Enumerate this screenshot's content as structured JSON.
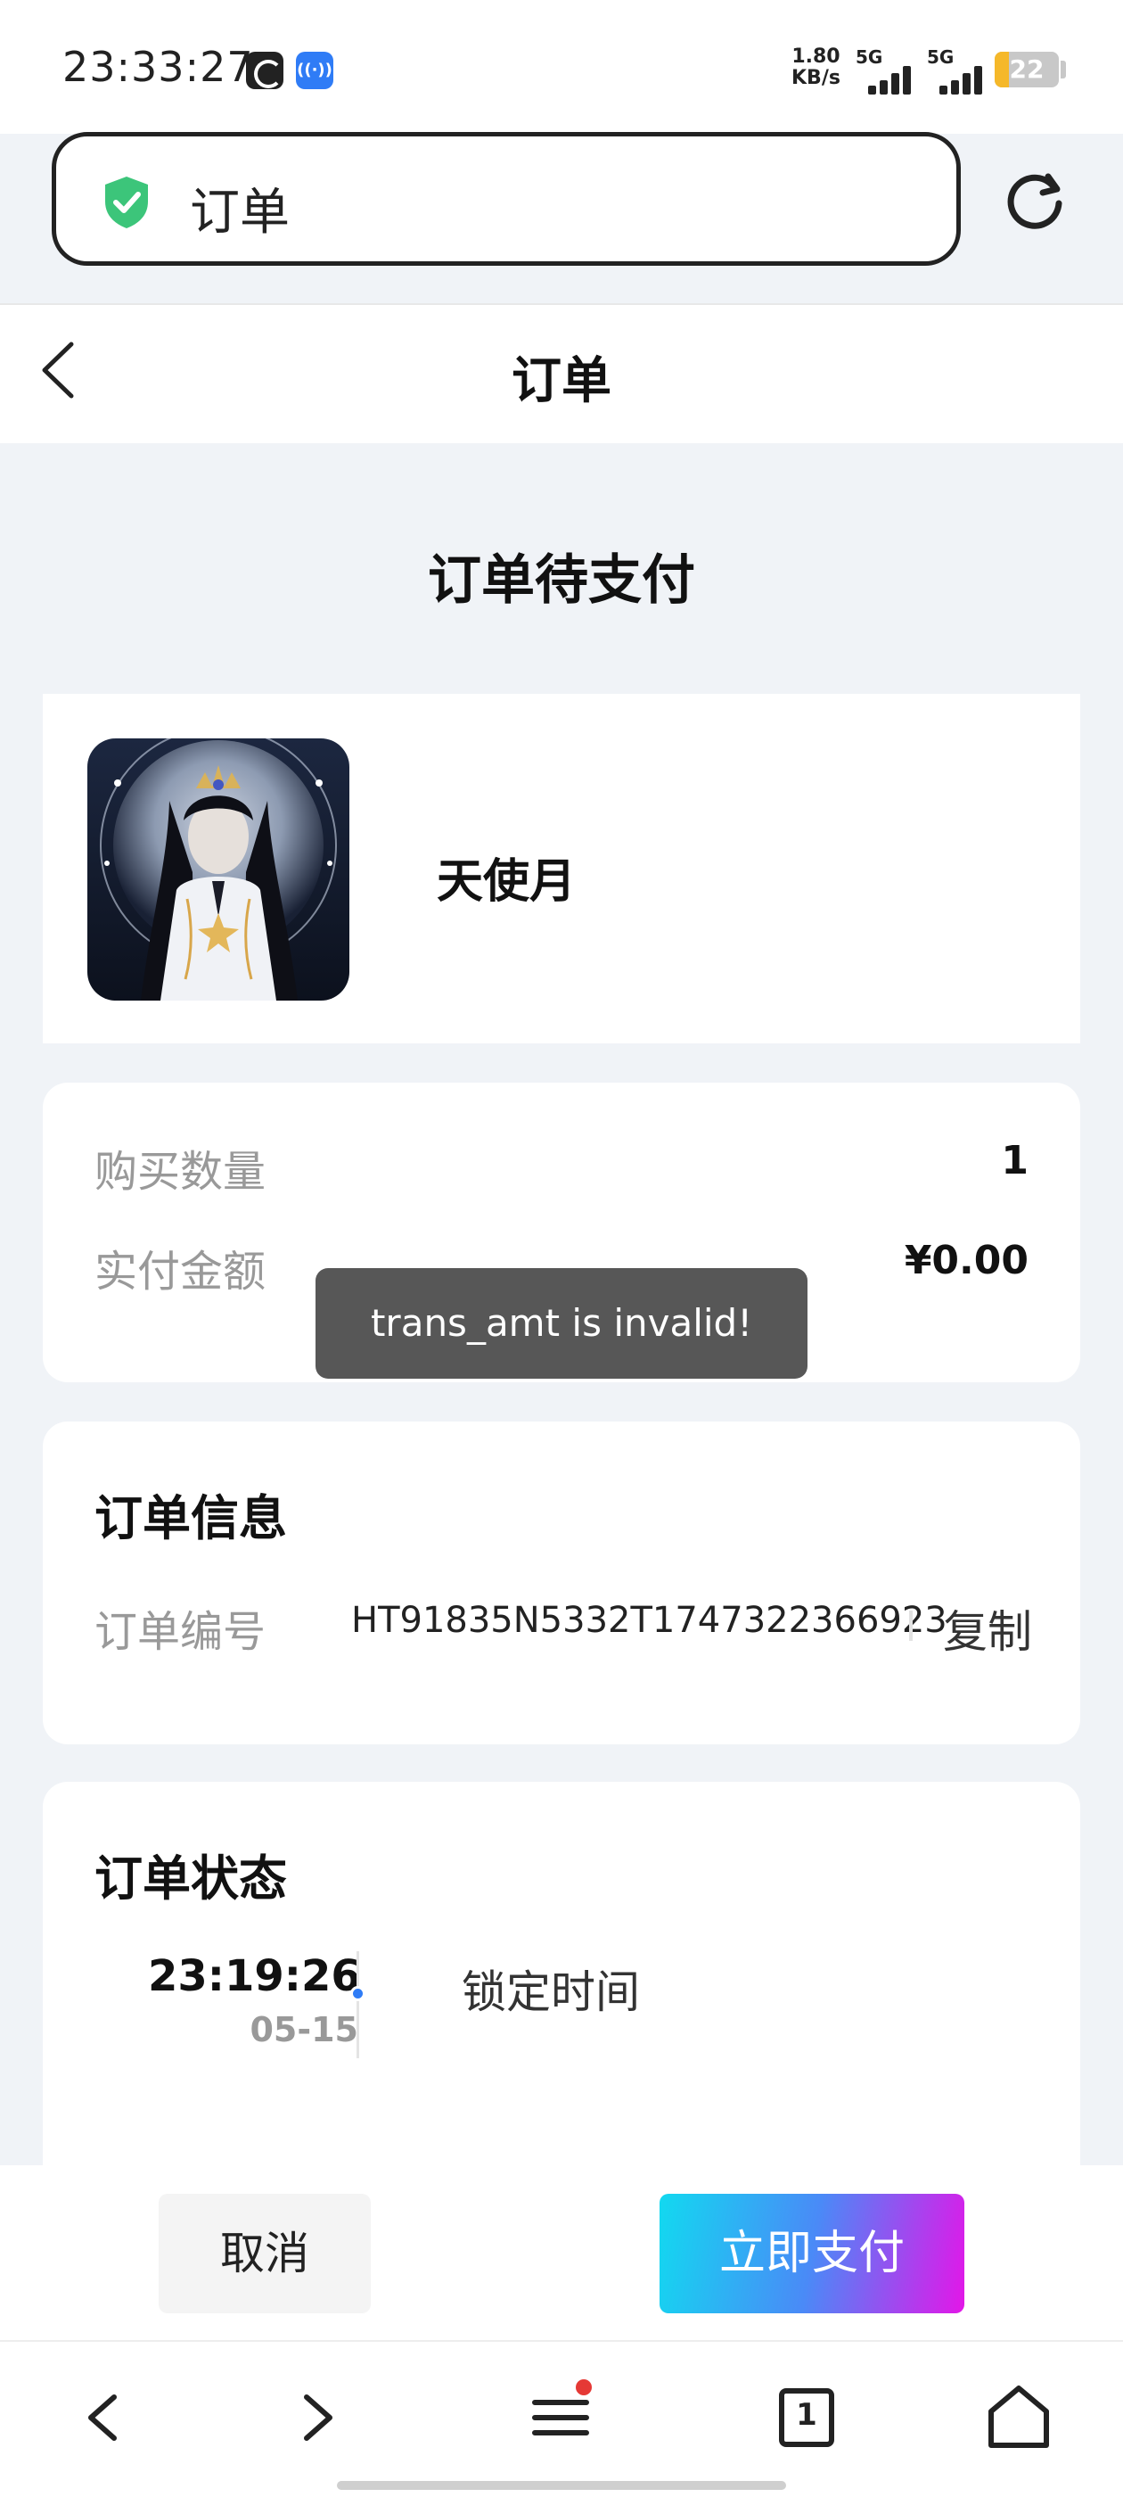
{
  "status_bar": {
    "time": "23:33:27",
    "network_speed_value": "1.80",
    "network_speed_unit": "KB/s",
    "signal1_label": "5G",
    "signal2_label": "5G",
    "battery_level": "22",
    "colors": {
      "battery_fill": "#f5b82a",
      "app_icon_blue": "#2f7cf6"
    },
    "icons": [
      "app-status-icon",
      "nfc-icon",
      "signal-icon",
      "battery-icon"
    ]
  },
  "address_bar": {
    "text": "订单",
    "security_icon": "shield-check-icon",
    "reload_icon": "refresh-icon"
  },
  "header": {
    "title": "订单",
    "back_icon": "chevron-left-icon"
  },
  "order": {
    "heading": "订单待支付",
    "product": {
      "name": "天使月",
      "image_icon": "product-thumbnail"
    },
    "summary": {
      "quantity_label": "购买数量",
      "quantity_value": "1",
      "amount_label": "实付金额",
      "amount_value": "¥0.00"
    },
    "info": {
      "title": "订单信息",
      "number_label": "订单编号",
      "number_value": "HT91835N5332T1747322366923",
      "copy_label": "复制"
    },
    "status": {
      "title": "订单状态",
      "timeline": [
        {
          "time": "23:19:26",
          "date": "05-15",
          "label": "锁定时间"
        }
      ],
      "dot_color": "#2f7cf6"
    }
  },
  "toast": {
    "message": "trans_amt is invalid!"
  },
  "actions": {
    "cancel_label": "取消",
    "pay_label": "立即支付",
    "pay_gradient": [
      "#12d9f0",
      "#4a8af7",
      "#e316e8"
    ]
  },
  "browser_nav": {
    "items": [
      "back-icon",
      "forward-icon",
      "menu-icon",
      "tabs-icon",
      "home-icon"
    ],
    "tab_count": "1",
    "menu_badge_color": "#e53935"
  }
}
